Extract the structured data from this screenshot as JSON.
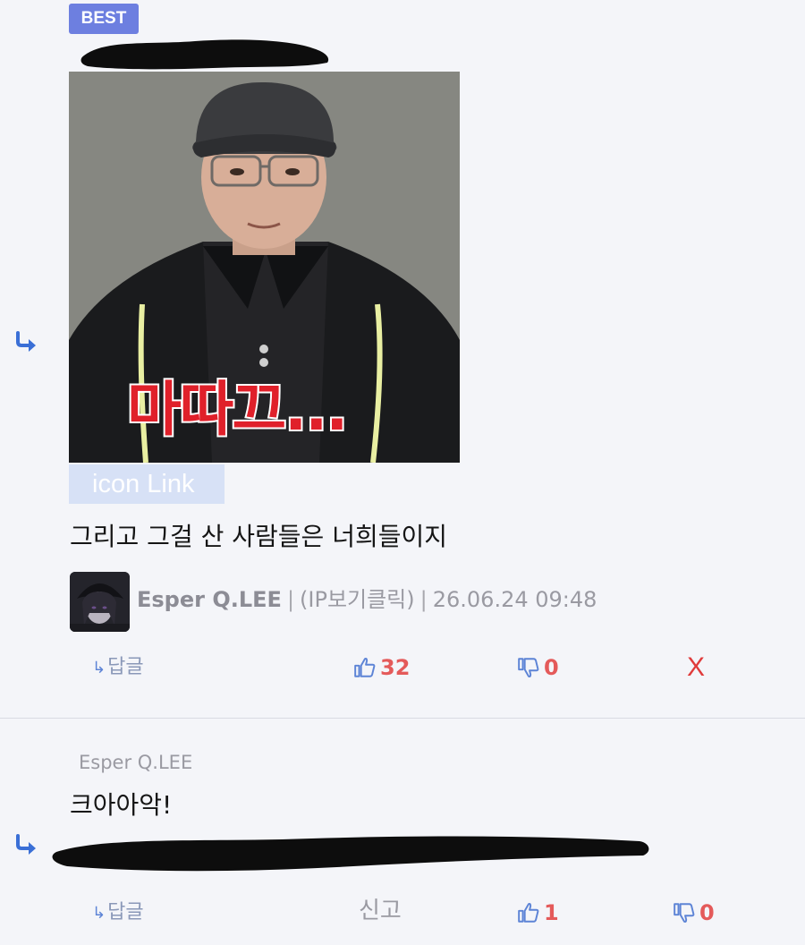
{
  "comment1": {
    "badge": "BEST",
    "image": {
      "caption": "마따끄...",
      "link_label": "icon Link"
    },
    "text": "그리고 그걸 산 사람들은 너희들이지",
    "author": {
      "name": "Esper Q.LEE",
      "ip_label": "(IP보기클릭)",
      "datetime": "26.06.24 09:48"
    },
    "actions": {
      "reply_label": "답글",
      "upvotes": "32",
      "downvotes": "0",
      "delete_label": "X"
    }
  },
  "comment2": {
    "reply_to": "Esper Q.LEE",
    "text": "크아아악!",
    "actions": {
      "reply_label": "답글",
      "report_label": "신고",
      "upvotes": "1",
      "downvotes": "0"
    }
  },
  "colors": {
    "best_badge": "#6d7fe0",
    "vote_count": "#e45a5a",
    "thumb_icon": "#5d84d6",
    "delete": "#e03b3b"
  },
  "icons": {
    "reply_indicator": "reply-arrow-icon",
    "upvote": "thumbs-up-icon",
    "downvote": "thumbs-down-icon"
  }
}
